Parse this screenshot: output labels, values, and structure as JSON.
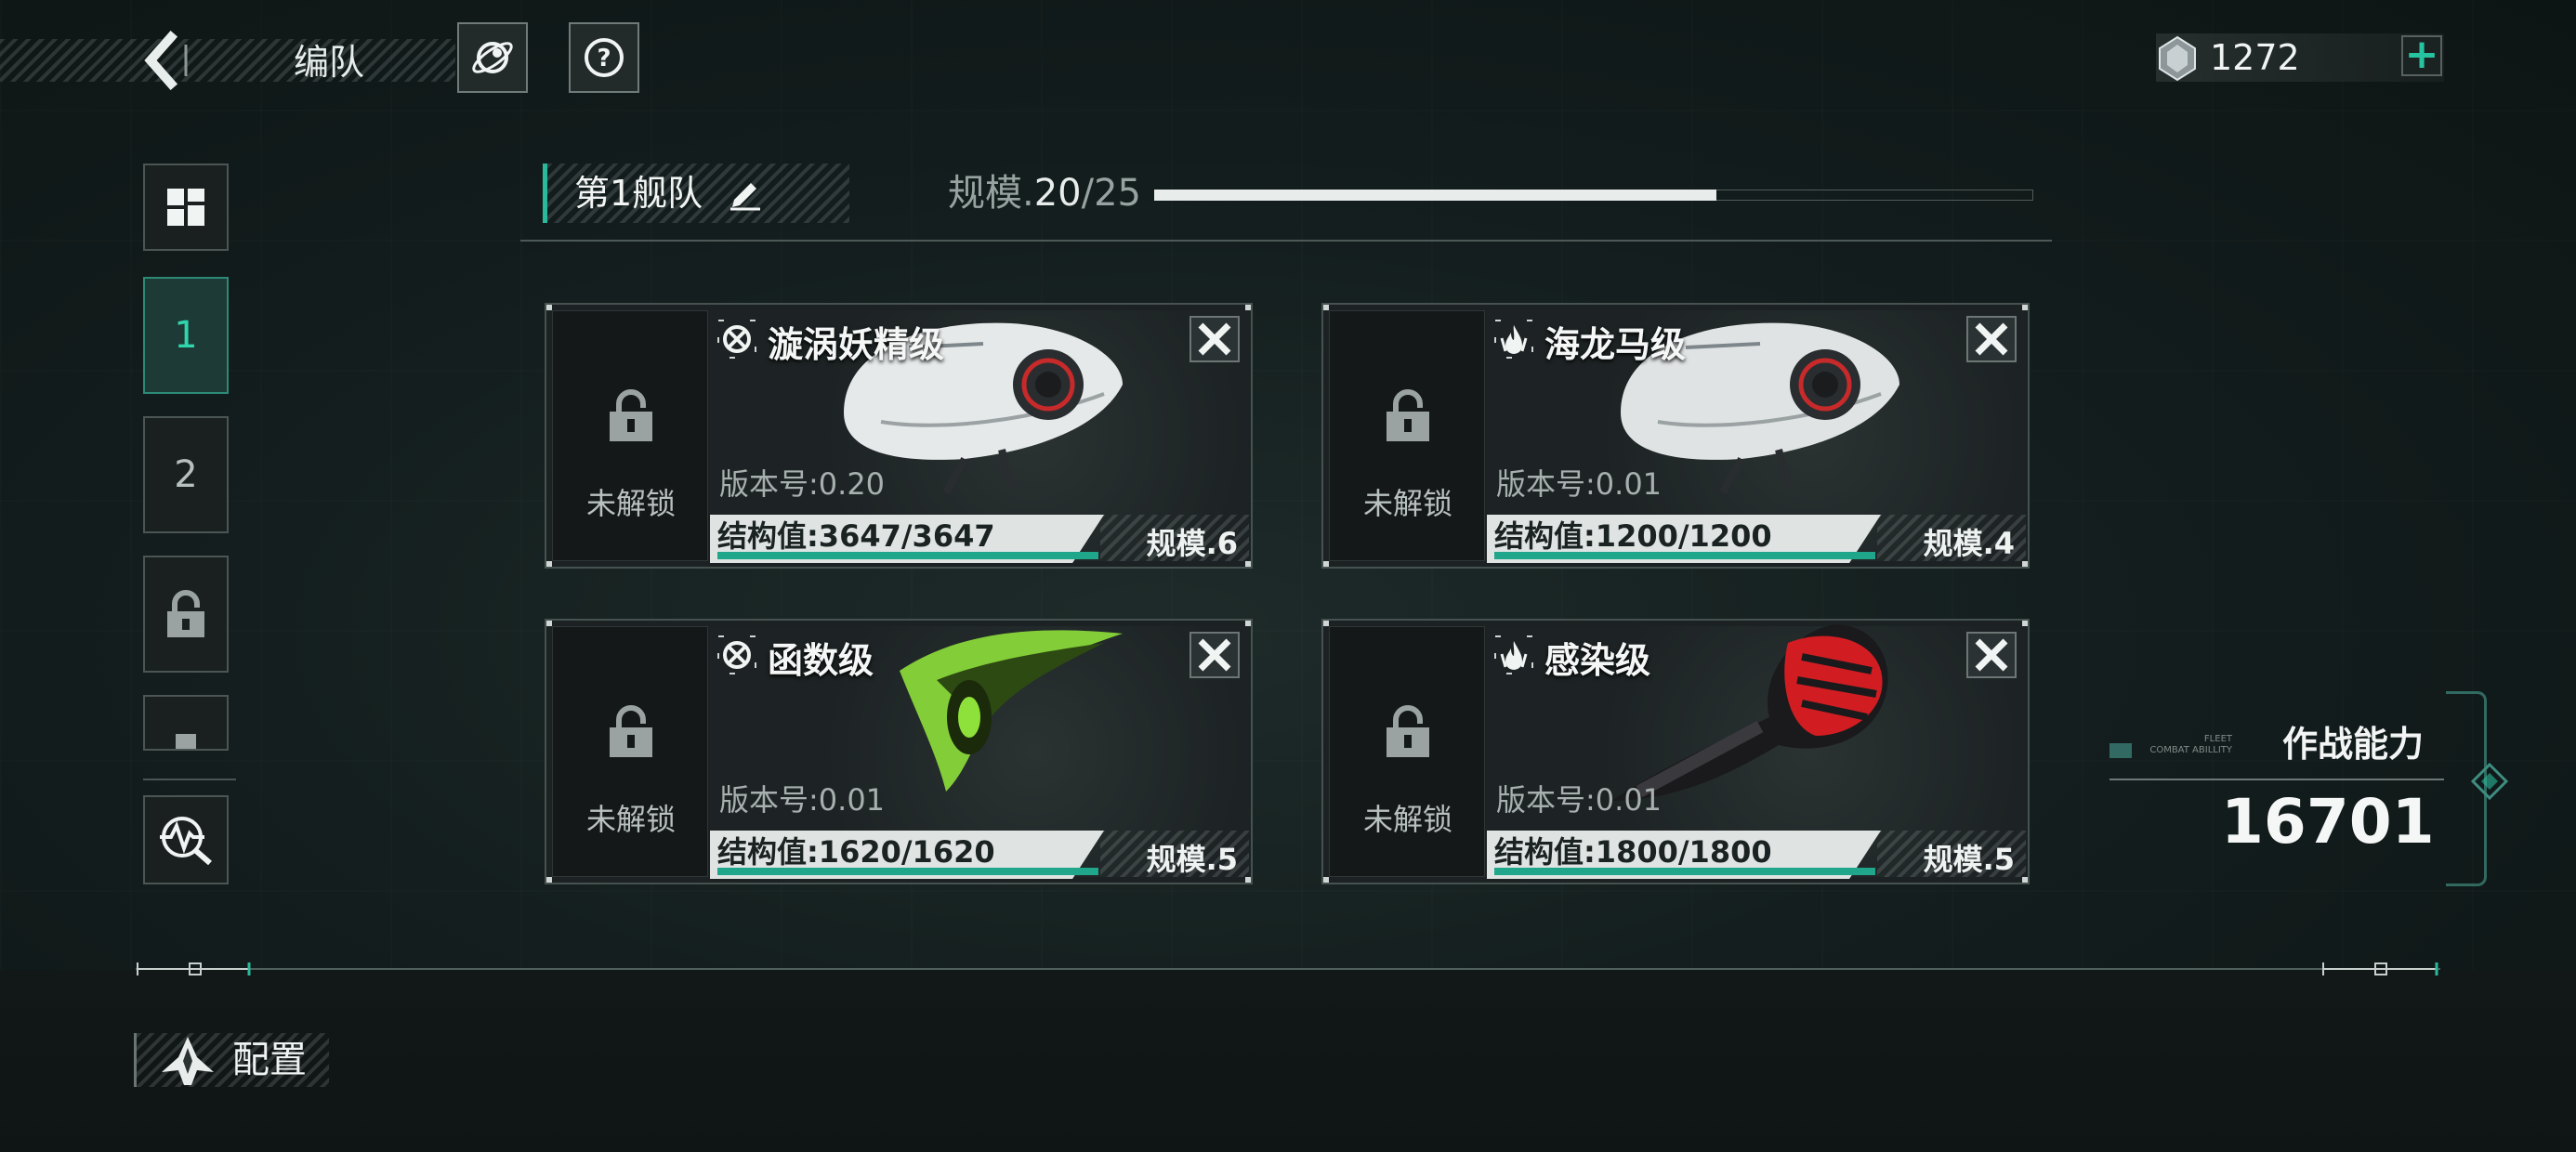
{
  "header": {
    "title": "编队",
    "back_icon": "back-arrow-icon",
    "buttons": [
      {
        "name": "planet-icon"
      },
      {
        "name": "help-icon"
      }
    ],
    "currency": {
      "value": "1272",
      "icon": "crystal-currency-icon",
      "add_label": "+"
    }
  },
  "sidebar": {
    "items": [
      {
        "name": "grid-view",
        "icon": "grid-icon"
      },
      {
        "label": "1",
        "active": true
      },
      {
        "label": "2"
      },
      {
        "name": "locked-slot",
        "icon": "lock-icon"
      },
      {
        "name": "locked-slot-partial",
        "icon": "lock-icon"
      },
      {
        "name": "analysis",
        "icon": "analysis-icon"
      }
    ]
  },
  "fleet": {
    "name": "第1舰队",
    "scale_label": "规模.",
    "scale_current": "20",
    "scale_sep": "/",
    "scale_max": "25",
    "scale_fraction": 0.8
  },
  "ships": [
    {
      "lock_text": "未解锁",
      "name": "漩涡妖精级",
      "class_icon": "target-icon",
      "version": "版本号:0.20",
      "hp": "结构值:3647/3647",
      "hp_fraction": 1.0,
      "scale": "规模.6",
      "art_color": "#e6e9ea"
    },
    {
      "lock_text": "未解锁",
      "name": "海龙马级",
      "class_icon": "flame-icon",
      "version": "版本号:0.01",
      "hp": "结构值:1200/1200",
      "hp_fraction": 1.0,
      "scale": "规模.4",
      "art_color": "#e0e3e4"
    },
    {
      "lock_text": "未解锁",
      "name": "函数级",
      "class_icon": "target-icon",
      "version": "版本号:0.01",
      "hp": "结构值:1620/1620",
      "hp_fraction": 1.0,
      "scale": "规模.5",
      "art_color": "#8ee03a"
    },
    {
      "lock_text": "未解锁",
      "name": "感染级",
      "class_icon": "flame-icon",
      "version": "版本号:0.01",
      "hp": "结构值:1800/1800",
      "hp_fraction": 1.0,
      "scale": "规模.5",
      "art_color": "#d11d22"
    }
  ],
  "combat": {
    "label": "作战能力",
    "sub_line1": "FLEET",
    "sub_line2": "COMBAT ABILLITY",
    "value": "16701"
  },
  "config": {
    "label": "配置",
    "icon": "ship-config-icon"
  },
  "colors": {
    "accent": "#2bb99b",
    "hp_fill": "#20a68a"
  }
}
